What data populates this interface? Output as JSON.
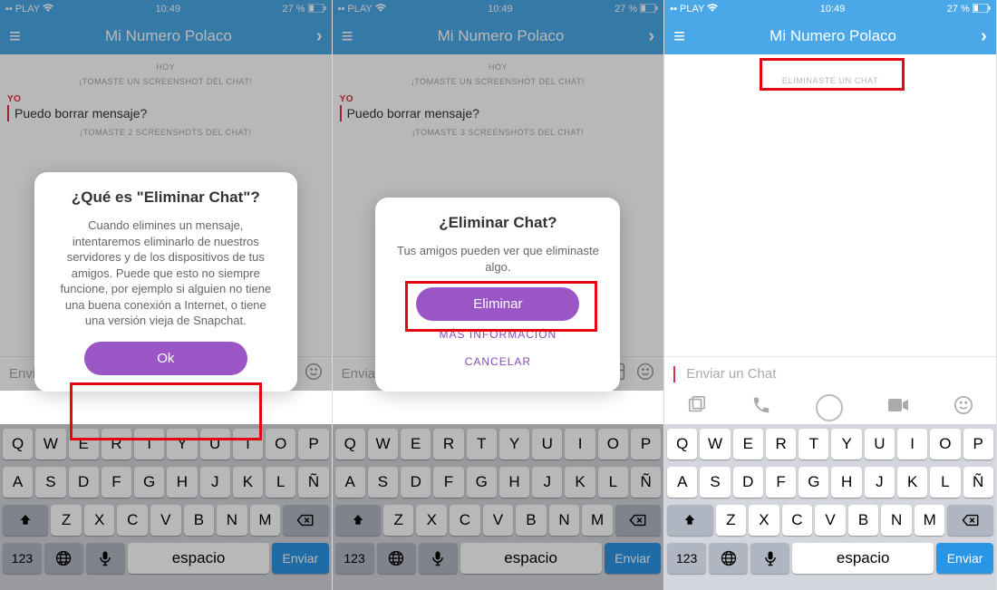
{
  "status": {
    "carrier": "PLAY",
    "time": "10:49",
    "battery": "27 %"
  },
  "header": {
    "title": "Mi Numero Polaco"
  },
  "chat": {
    "day": "HOY",
    "screenshot1": "¡TOMASTE UN SCREENSHOT DEL CHAT!",
    "screenshot2": "¡TOMASTE 2 SCREENSHOTS DEL CHAT!",
    "screenshot3": "¡TOMASTE 3 SCREENSHOTS DEL CHAT!",
    "sender": "YO",
    "msg": "Puedo borrar mensaje?",
    "deleted": "ELIMINASTE UN CHAT"
  },
  "input": {
    "placeholder": "Enviar un Chat"
  },
  "modal1": {
    "title": "¿Qué es \"Eliminar Chat\"?",
    "body": "Cuando elimines un mensaje, intentaremos eliminarlo de nuestros servidores y de los dispositivos de tus amigos. Puede que esto no siempre funcione, por ejemplo si alguien no tiene una buena conexión a Internet, o tiene una versión vieja de Snapchat.",
    "ok": "Ok"
  },
  "modal2": {
    "title": "¿Eliminar Chat?",
    "body": "Tus amigos pueden ver que eliminaste algo.",
    "eliminar": "Eliminar",
    "info": "MÁS INFORMACIÓN",
    "cancel": "CANCELAR"
  },
  "keyboard": {
    "row1": [
      "Q",
      "W",
      "E",
      "R",
      "T",
      "Y",
      "U",
      "I",
      "O",
      "P"
    ],
    "row2": [
      "A",
      "S",
      "D",
      "F",
      "G",
      "H",
      "J",
      "K",
      "L",
      "Ñ"
    ],
    "row3": [
      "Z",
      "X",
      "C",
      "V",
      "B",
      "N",
      "M"
    ],
    "numbers": "123",
    "space": "espacio",
    "send": "Enviar"
  }
}
